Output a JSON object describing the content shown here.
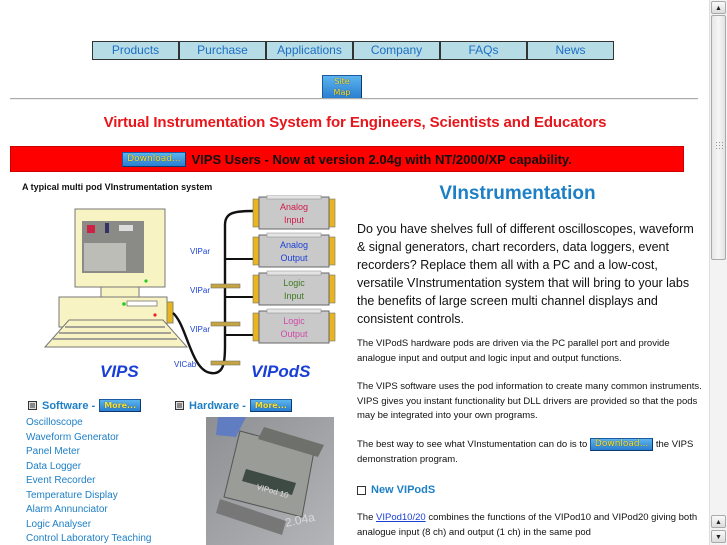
{
  "nav": {
    "items": [
      "Products",
      "Purchase",
      "Applications",
      "Company",
      "FAQs",
      "News"
    ],
    "sitemap_label": "Site Map"
  },
  "tagline": "Virtual Instrumentation System for Engineers, Scientists and Educators",
  "banner": {
    "download_label": "Download...",
    "text": "VIPS Users - Now at version 2.04g with NT/2000/XP capability.",
    "color": "#ff0000"
  },
  "diagram": {
    "title": "A typical multi pod VInstrumentation system",
    "pc_label": "VIPS",
    "pods_label": "VIPodS",
    "cable_labels": [
      "VIPar",
      "VIPar",
      "VIPar",
      "VICab"
    ],
    "pods": [
      {
        "line1": "Analog",
        "line2": "Input",
        "color": "#d11a4a"
      },
      {
        "line1": "Analog",
        "line2": "Output",
        "color": "#1a3fd6"
      },
      {
        "line1": "Logic",
        "line2": "Input",
        "color": "#3f7a22"
      },
      {
        "line1": "Logic",
        "line2": "Output",
        "color": "#d04aa8"
      }
    ]
  },
  "software": {
    "heading": "Software -",
    "more_label": "More...",
    "items": [
      "Oscilloscope",
      "Waveform Generator",
      "Panel Meter",
      "Data Logger",
      "Event Recorder",
      "Temperature Display",
      "Alarm Annunciator",
      "Logic Analyser",
      "Control Laboratory Teaching"
    ]
  },
  "hardware": {
    "heading": "Hardware -",
    "more_label": "More...",
    "photo_label": "VIPod 10",
    "photo_caption": "2.04a"
  },
  "main": {
    "title": "VInstrumentation",
    "intro": "Do you have shelves full of different oscilloscopes, waveform & signal generators, chart recorders, data loggers, event recorders? Replace them all with a PC and a low-cost, versatile VInstrumentation system that will bring to your labs the benefits of large screen multi channel displays and consistent controls.",
    "para1": "The VIPodS hardware pods are driven via the PC parallel port and provide analogue input and output and logic input and output functions.",
    "para2": "The VIPS software uses the pod information to create many common instruments. VIPS gives you instant functionality but DLL drivers are provided so that the pods may be integrated into your own programs.",
    "para3_before": "The best way to see what VInstumentation can do is to",
    "para3_download": "Download...",
    "para3_after": "the VIPS demonstration program.",
    "new_heading": "New VIPodS",
    "para4_before": "The",
    "para4_link": "VIPod10/20",
    "para4_after": "combines the functions of the VIPod10 and VIPod20 giving both analogue input (8 ch) and output (1 ch) in the same pod"
  },
  "colors": {
    "accent_blue": "#1d7fc6",
    "tagline_red": "#e8151b",
    "nav_bg": "#b6dce6"
  }
}
